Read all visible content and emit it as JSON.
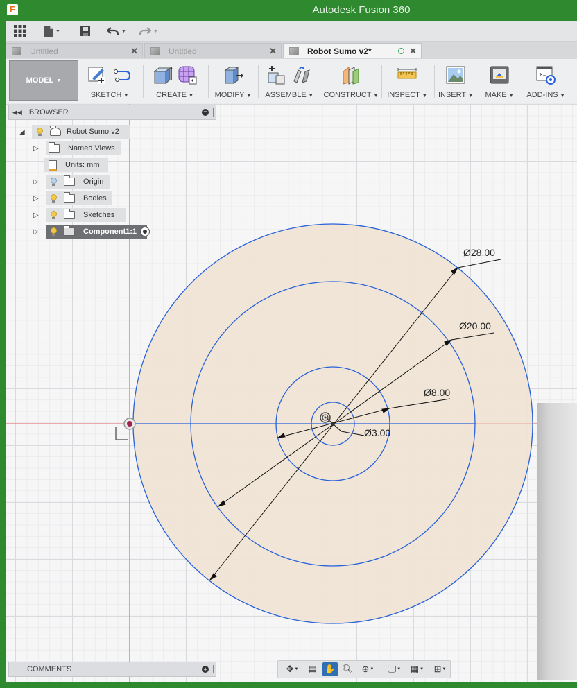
{
  "app": {
    "title": "Autodesk Fusion 360",
    "logo_letter": "F"
  },
  "quick_access": {
    "grid_icon": "app-grid-icon",
    "file_icon": "file-icon",
    "save_icon": "save-icon",
    "undo_icon": "undo-icon",
    "redo_icon": "redo-icon"
  },
  "tabs": [
    {
      "label": "Untitled",
      "active": false
    },
    {
      "label": "Untitled",
      "active": false
    },
    {
      "label": "Robot Sumo v2*",
      "active": true
    }
  ],
  "toolbar": {
    "workspace": "MODEL",
    "groups": [
      {
        "label": "SKETCH"
      },
      {
        "label": "CREATE"
      },
      {
        "label": "MODIFY"
      },
      {
        "label": "ASSEMBLE"
      },
      {
        "label": "CONSTRUCT"
      },
      {
        "label": "INSPECT"
      },
      {
        "label": "INSERT"
      },
      {
        "label": "MAKE"
      },
      {
        "label": "ADD-INS"
      }
    ]
  },
  "browser": {
    "title": "BROWSER",
    "root": "Robot Sumo v2",
    "items": [
      {
        "label": "Named Views"
      },
      {
        "label": "Units: mm"
      },
      {
        "label": "Origin"
      },
      {
        "label": "Bodies"
      },
      {
        "label": "Sketches"
      },
      {
        "label": "Component1:1"
      }
    ]
  },
  "comments": {
    "title": "COMMENTS"
  },
  "sketch": {
    "dimensions": [
      {
        "label": "Ø28.00"
      },
      {
        "label": "Ø20.00"
      },
      {
        "label": "Ø8.00"
      },
      {
        "label": "Ø3.00"
      }
    ],
    "colors": {
      "circle": "#2962d9",
      "fill": "#f0e3d3",
      "x_axis": "#e06060",
      "y_axis": "#58c058"
    }
  }
}
